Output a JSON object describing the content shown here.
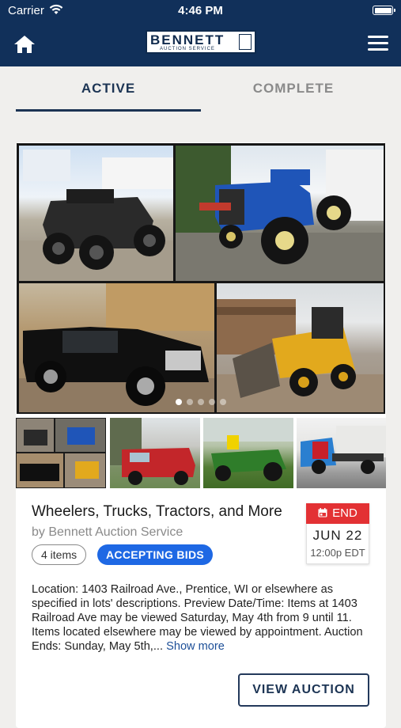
{
  "status_bar": {
    "carrier": "Carrier",
    "time": "4:46 PM"
  },
  "nav": {
    "logo_text": "BENNETT",
    "logo_subtext": "AUCTION SERVICE",
    "home_icon": "home-icon",
    "menu_icon": "hamburger-menu-icon",
    "brand_color": "#11305a"
  },
  "tabs": [
    {
      "label": "ACTIVE",
      "selected": true
    },
    {
      "label": "COMPLETE",
      "selected": false
    }
  ],
  "auction": {
    "title": "Wheelers, Trucks, Tractors, and More",
    "byline": "by Bennett Auction Service",
    "items_count": "4 items",
    "status": "ACCEPTING BIDS",
    "end_label": "END",
    "end_date": "JUN 22",
    "end_time": "12:00p EDT",
    "description": "Location: 1403 Railroad Ave., Prentice, WI or elsewhere as specified in lots' descriptions. Preview Date/Time: Items at 1403 Railroad Ave may be viewed Saturday, May 4th from 9 until 11. Items located elsewhere may be viewed by appointment. Auction Ends: Sunday, May 5th,...",
    "show_more": "Show more",
    "view_button": "VIEW AUCTION",
    "carousel_index": 1,
    "carousel_count": 5,
    "status_color": "#1e68e4",
    "end_color": "#e33134"
  }
}
